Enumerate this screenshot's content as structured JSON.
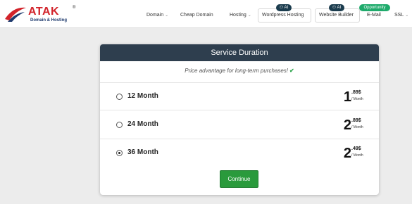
{
  "brand": {
    "name": "ATAK",
    "tagline": "Domain & Hosting",
    "registered_mark": "®",
    "color": "#d2232a"
  },
  "nav": {
    "items": [
      {
        "label": "Domain",
        "has_caret": true
      },
      {
        "label": "Cheap Domain",
        "has_caret": false
      },
      {
        "label": "Hosting",
        "has_caret": true
      },
      {
        "label": "Wordpress Hosting",
        "badge": "AI"
      },
      {
        "label": "Website Builder",
        "badge": "AI"
      },
      {
        "label": "E-Mail",
        "badge": "Opportunity"
      },
      {
        "label": "SSL",
        "has_caret": true
      }
    ]
  },
  "card": {
    "title": "Service Duration",
    "subtitle": "Price advantage for long-term purchases!",
    "check_icon": "✔",
    "options": [
      {
        "label": "12 Month",
        "price_whole": "1",
        "price_decimal": ".89$",
        "per": "/ Month",
        "selected": false
      },
      {
        "label": "24 Month",
        "price_whole": "2",
        "price_decimal": ".89$",
        "per": "/ Month",
        "selected": false
      },
      {
        "label": "36 Month",
        "price_whole": "2",
        "price_decimal": ".49$",
        "per": "/ Month",
        "selected": true
      }
    ],
    "continue_label": "Continue"
  },
  "colors": {
    "header_bar": "#2e3e4e",
    "continue_button": "#2a9a3c",
    "check": "#2aa34a"
  }
}
